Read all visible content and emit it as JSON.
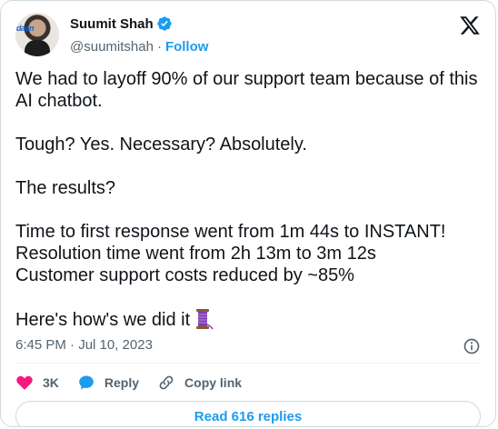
{
  "author": {
    "display_name": "Suumit Shah",
    "handle": "@suumitshah",
    "separator": "·",
    "follow_label": "Follow",
    "avatar_badge_text": "daan"
  },
  "tweet": {
    "lines": [
      "We had to layoff 90% of our support team because of this",
      "AI chatbot.",
      "",
      "Tough? Yes. Necessary? Absolutely.",
      "",
      "The results?",
      "",
      "Time to first response went from 1m 44s to INSTANT!",
      "Resolution time went from 2h 13m to 3m 12s",
      "Customer support costs reduced by ~85%",
      "",
      "Here's how's we did it"
    ],
    "trailing_emoji_icon": "thread-spool-icon",
    "timestamp": "6:45 PM · Jul 10, 2023"
  },
  "actions": {
    "likes_count": "3K",
    "reply_label": "Reply",
    "copy_link_label": "Copy link"
  },
  "footer": {
    "read_replies_label": "Read 616 replies"
  },
  "colors": {
    "accent": "#1d9bf0",
    "like": "#f91880",
    "text": "#0f1419",
    "muted": "#536471",
    "border": "#cfd9de"
  }
}
